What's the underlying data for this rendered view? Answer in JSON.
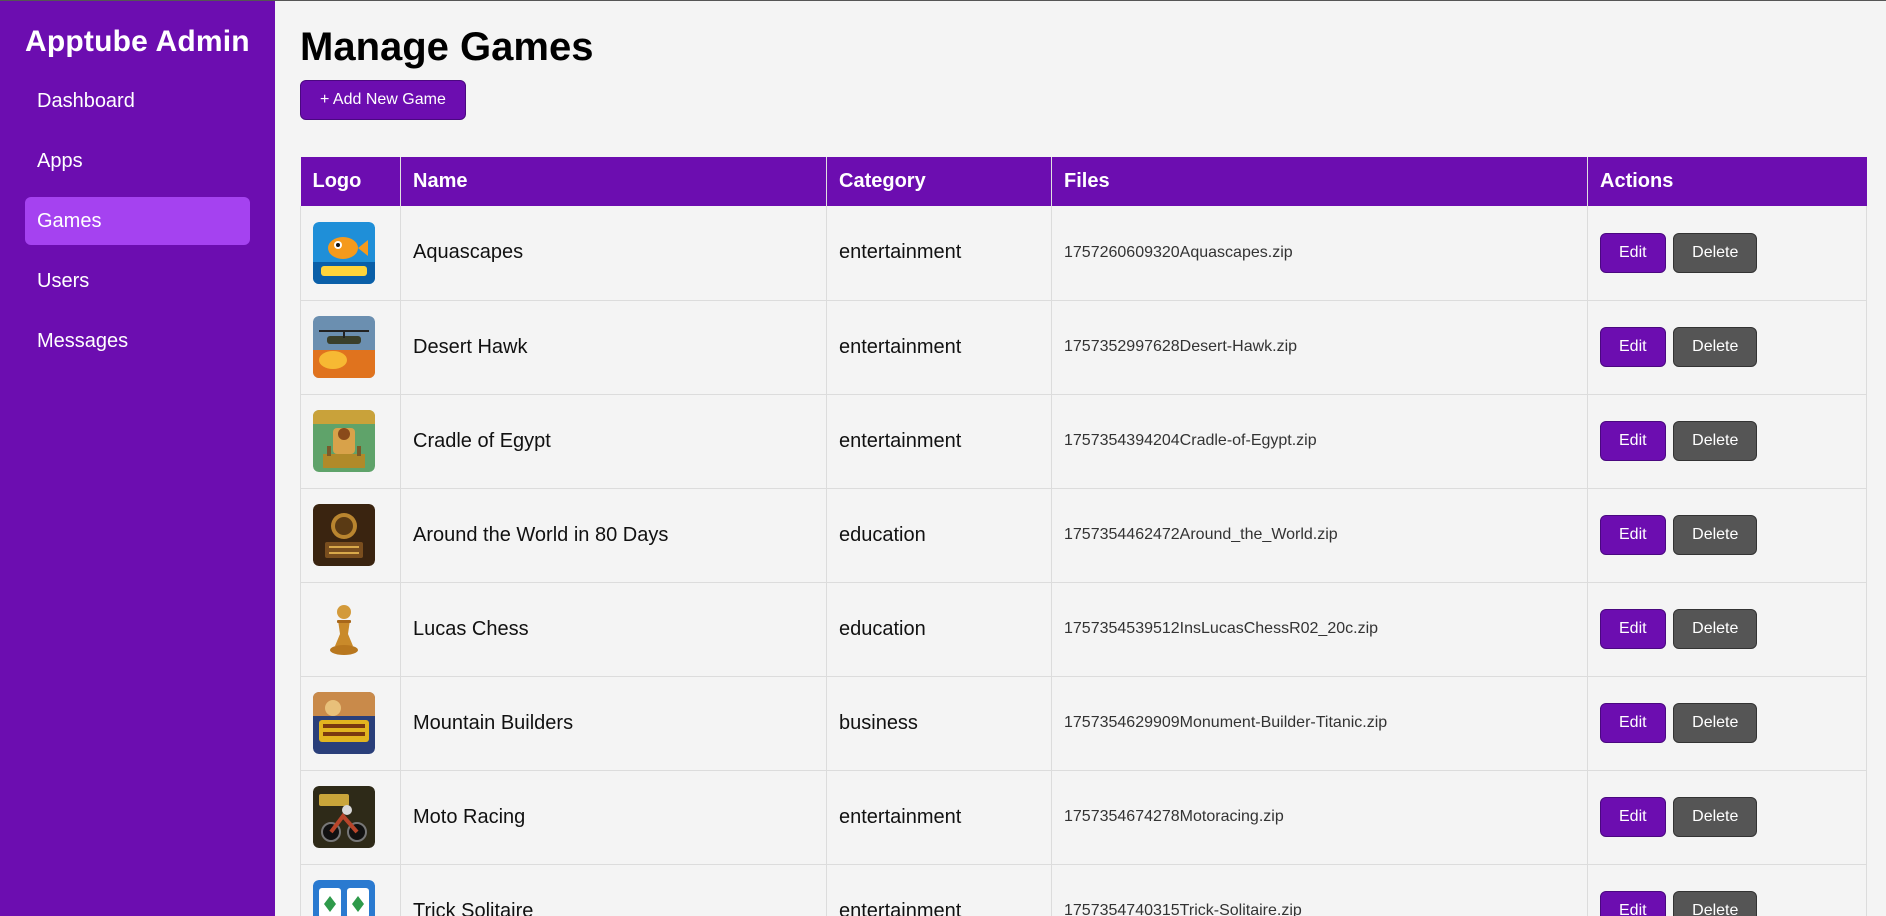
{
  "sidebar": {
    "brand": "Apptube Admin",
    "items": [
      {
        "label": "Dashboard"
      },
      {
        "label": "Apps"
      },
      {
        "label": "Games",
        "active": true
      },
      {
        "label": "Users"
      },
      {
        "label": "Messages"
      }
    ]
  },
  "main": {
    "title": "Manage Games",
    "add_button": "+ Add New Game"
  },
  "table": {
    "headers": [
      "Logo",
      "Name",
      "Category",
      "Files",
      "Actions"
    ],
    "edit_label": "Edit",
    "delete_label": "Delete",
    "rows": [
      {
        "name": "Aquascapes",
        "category": "entertainment",
        "file": "1757260609320Aquascapes.zip"
      },
      {
        "name": "Desert Hawk",
        "category": "entertainment",
        "file": "1757352997628Desert-Hawk.zip"
      },
      {
        "name": "Cradle of Egypt",
        "category": "entertainment",
        "file": "1757354394204Cradle-of-Egypt.zip"
      },
      {
        "name": "Around the World in 80 Days",
        "category": "education",
        "file": "1757354462472Around_the_World.zip"
      },
      {
        "name": "Lucas Chess",
        "category": "education",
        "file": "1757354539512InsLucasChessR02_20c.zip"
      },
      {
        "name": "Mountain Builders",
        "category": "business",
        "file": "1757354629909Monument-Builder-Titanic.zip"
      },
      {
        "name": "Moto Racing",
        "category": "entertainment",
        "file": "1757354674278Motoracing.zip"
      },
      {
        "name": "Trick Solitaire",
        "category": "entertainment",
        "file": "1757354740315Trick-Solitaire.zip"
      }
    ]
  },
  "colors": {
    "brand_purple": "#6c0db0",
    "active_nav": "#a542f0",
    "delete_gray": "#555555"
  }
}
